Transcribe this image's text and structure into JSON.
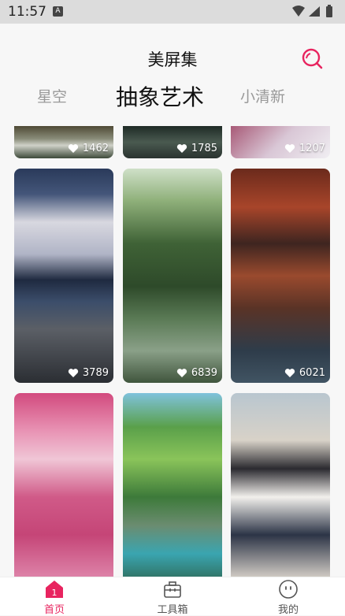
{
  "status": {
    "time": "11:57",
    "app_icon_letter": "A"
  },
  "header": {
    "title": "美屏集"
  },
  "tabs": [
    {
      "label": "星空",
      "active": false
    },
    {
      "label": "抽象艺术",
      "active": true
    },
    {
      "label": "小清新",
      "active": false
    }
  ],
  "wallpapers": [
    {
      "likes": "1462"
    },
    {
      "likes": "1785"
    },
    {
      "likes": "1207"
    },
    {
      "likes": "3789"
    },
    {
      "likes": "6839"
    },
    {
      "likes": "6021"
    },
    {
      "likes": ""
    },
    {
      "likes": ""
    },
    {
      "likes": ""
    }
  ],
  "nav": {
    "home": "首页",
    "tools": "工具箱",
    "mine": "我的",
    "home_badge": "1"
  },
  "colors": {
    "accent": "#e8245f",
    "tab_inactive": "#999999"
  }
}
